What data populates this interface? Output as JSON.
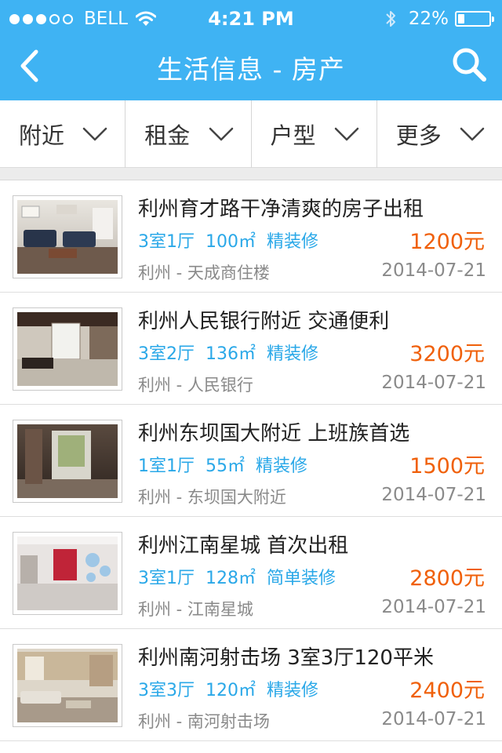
{
  "status_bar": {
    "carrier": "BELL",
    "time": "4:21 PM",
    "battery": "22%",
    "battery_level": 0.22,
    "signal_bars_filled": 3,
    "signal_bars_total": 5
  },
  "nav": {
    "title": "生活信息 - 房产",
    "back_icon": "back-chevron-icon",
    "search_icon": "search-icon"
  },
  "filters": [
    {
      "label": "附近"
    },
    {
      "label": "租金"
    },
    {
      "label": "户型"
    },
    {
      "label": "更多"
    }
  ],
  "listings": [
    {
      "title": "利州育才路干净清爽的房子出租",
      "rooms": "3室1厅",
      "area": "100㎡",
      "decoration": "精装修",
      "price": "1200元",
      "location": "利州 - 天成商住楼",
      "date": "2014-07-21"
    },
    {
      "title": "利州人民银行附近 交通便利",
      "rooms": "3室2厅",
      "area": "136㎡",
      "decoration": "精装修",
      "price": "3200元",
      "location": "利州 - 人民银行",
      "date": "2014-07-21"
    },
    {
      "title": "利州东坝国大附近 上班族首选",
      "rooms": "1室1厅",
      "area": "55㎡",
      "decoration": "精装修",
      "price": "1500元",
      "location": "利州 - 东坝国大附近",
      "date": "2014-07-21"
    },
    {
      "title": "利州江南星城 首次出租",
      "rooms": "3室1厅",
      "area": "128㎡",
      "decoration": "简单装修",
      "price": "2800元",
      "location": "利州 - 江南星城",
      "date": "2014-07-21"
    },
    {
      "title": "利州南河射击场 3室3厅120平米",
      "rooms": "3室3厅",
      "area": "120㎡",
      "decoration": "精装修",
      "price": "2400元",
      "location": "利州 - 南河射击场",
      "date": "2014-07-21"
    }
  ],
  "colors": {
    "header": "#3fb3f3",
    "spec_text": "#2aa8e8",
    "price": "#f0600a",
    "muted": "#8a8a8a"
  }
}
